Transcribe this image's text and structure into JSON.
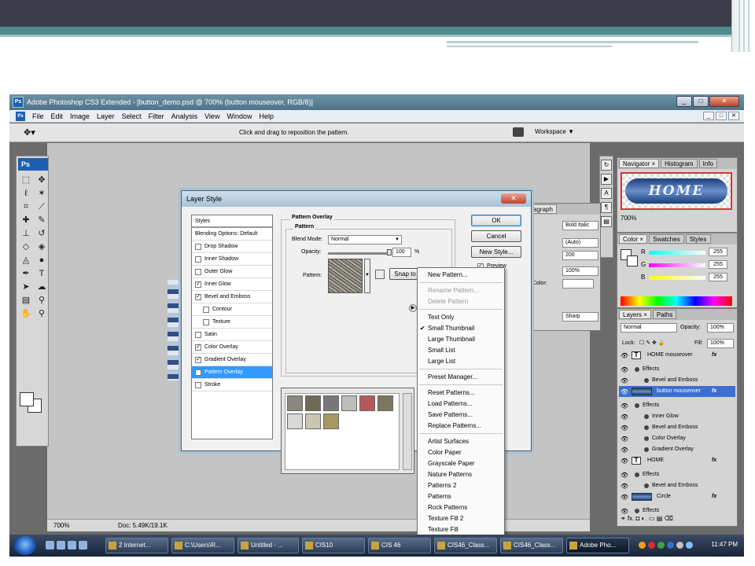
{
  "window": {
    "title": "Adobe Photoshop CS3 Extended - [button_demo.psd @ 700% (button mouseover, RGB/8)]",
    "app_icon": "Ps",
    "btn_min": "_",
    "btn_max": "□",
    "btn_close": "✕"
  },
  "menu": [
    "File",
    "Edit",
    "Image",
    "Layer",
    "Select",
    "Filter",
    "Analysis",
    "View",
    "Window",
    "Help"
  ],
  "options_bar": {
    "hint": "Click and drag to reposition the pattern.",
    "workspace": "Workspace ▼"
  },
  "toolbox": {
    "logo": "Ps"
  },
  "status": {
    "zoom": "700%",
    "doc": "Doc: 5.49K/19.1K"
  },
  "dialog": {
    "title": "Layer Style",
    "styles_header": "Styles",
    "blending": "Blending Options: Default",
    "style_items": [
      {
        "label": "Drop Shadow",
        "checked": false,
        "sub": false
      },
      {
        "label": "Inner Shadow",
        "checked": false,
        "sub": false
      },
      {
        "label": "Outer Glow",
        "checked": false,
        "sub": false
      },
      {
        "label": "Inner Glow",
        "checked": true,
        "sub": false
      },
      {
        "label": "Bevel and Emboss",
        "checked": true,
        "sub": false
      },
      {
        "label": "Contour",
        "checked": false,
        "sub": true
      },
      {
        "label": "Texture",
        "checked": false,
        "sub": true
      },
      {
        "label": "Satin",
        "checked": false,
        "sub": false
      },
      {
        "label": "Color Overlay",
        "checked": true,
        "sub": false
      },
      {
        "label": "Gradient Overlay",
        "checked": true,
        "sub": false
      },
      {
        "label": "Pattern Overlay",
        "checked": true,
        "sub": false,
        "selected": true
      },
      {
        "label": "Stroke",
        "checked": false,
        "sub": false
      }
    ],
    "section_title": "Pattern Overlay",
    "group_title": "Pattern",
    "blend_mode_label": "Blend Mode:",
    "blend_mode_value": "Normal",
    "opacity_label": "Opacity:",
    "opacity_value": "100",
    "opacity_unit": "%",
    "opacity": 1.0,
    "pattern_label": "Pattern:",
    "snap_label": "Snap to",
    "ok": "OK",
    "cancel": "Cancel",
    "new_style": "New Style...",
    "preview": "Preview",
    "preview_checked": true
  },
  "pattern_menu": {
    "items": [
      {
        "label": "New Pattern...",
        "disabled": false,
        "checked": false,
        "sep_after": true
      },
      {
        "label": "Rename Pattern...",
        "disabled": true,
        "checked": false,
        "sep_after": false
      },
      {
        "label": "Delete Pattern",
        "disabled": true,
        "checked": false,
        "sep_after": true
      },
      {
        "label": "Text Only",
        "disabled": false,
        "checked": false,
        "sep_after": false
      },
      {
        "label": "Small Thumbnail",
        "disabled": false,
        "checked": true,
        "sep_after": false
      },
      {
        "label": "Large Thumbnail",
        "disabled": false,
        "checked": false,
        "sep_after": false
      },
      {
        "label": "Small List",
        "disabled": false,
        "checked": false,
        "sep_after": false
      },
      {
        "label": "Large List",
        "disabled": false,
        "checked": false,
        "sep_after": true
      },
      {
        "label": "Preset Manager...",
        "disabled": false,
        "checked": false,
        "sep_after": true
      },
      {
        "label": "Reset Patterns...",
        "disabled": false,
        "checked": false,
        "sep_after": false
      },
      {
        "label": "Load Patterns...",
        "disabled": false,
        "checked": false,
        "sep_after": false
      },
      {
        "label": "Save Patterns...",
        "disabled": false,
        "checked": false,
        "sep_after": false
      },
      {
        "label": "Replace Patterns...",
        "disabled": false,
        "checked": false,
        "sep_after": true
      },
      {
        "label": "Artist Surfaces",
        "disabled": false,
        "checked": false,
        "sep_after": false
      },
      {
        "label": "Color Paper",
        "disabled": false,
        "checked": false,
        "sep_after": false
      },
      {
        "label": "Grayscale Paper",
        "disabled": false,
        "checked": false,
        "sep_after": false
      },
      {
        "label": "Nature Patterns",
        "disabled": false,
        "checked": false,
        "sep_after": false
      },
      {
        "label": "Patterns 2",
        "disabled": false,
        "checked": false,
        "sep_after": false
      },
      {
        "label": "Patterns",
        "disabled": false,
        "checked": false,
        "sep_after": false
      },
      {
        "label": "Rock Patterns",
        "disabled": false,
        "checked": false,
        "sep_after": false
      },
      {
        "label": "Texture Fill 2",
        "disabled": false,
        "checked": false,
        "sep_after": false
      },
      {
        "label": "Texture Fill",
        "disabled": false,
        "checked": false,
        "sep_after": false
      }
    ],
    "check_mark": "✔"
  },
  "char_panel": {
    "tab": "agraph",
    "font_style": "Bold Italic",
    "leading": "(Auto)",
    "tracking": "200",
    "scale": "100%",
    "color_label": "Color:",
    "aa": "Sharp"
  },
  "navigator": {
    "tabs": [
      "Navigator ×",
      "Histogram",
      "Info"
    ],
    "preview_text": "HOME",
    "zoom": "700%"
  },
  "color_panel": {
    "tabs": [
      "Color ×",
      "Swatches",
      "Styles"
    ],
    "channels": [
      {
        "label": "R",
        "value": "255"
      },
      {
        "label": "G",
        "value": "255"
      },
      {
        "label": "B",
        "value": "255"
      }
    ]
  },
  "layers_panel": {
    "tabs": [
      "Layers ×",
      "Paths"
    ],
    "blend": "Normal",
    "opacity_label": "Opacity:",
    "opacity": "100%",
    "lock_label": "Lock:",
    "fill_label": "Fill:",
    "fill": "100%",
    "rows": [
      {
        "type": "layer",
        "name": "HOME mouseover",
        "thumb": "T",
        "fx": true,
        "selected": false
      },
      {
        "type": "effects",
        "name": "Effects"
      },
      {
        "type": "effect",
        "name": "Bevel and Emboss"
      },
      {
        "type": "layer",
        "name": "button mouseover",
        "thumb": "blue",
        "fx": true,
        "selected": true
      },
      {
        "type": "effects",
        "name": "Effects"
      },
      {
        "type": "effect",
        "name": "Inner Glow"
      },
      {
        "type": "effect",
        "name": "Bevel and Emboss"
      },
      {
        "type": "effect",
        "name": "Color Overlay"
      },
      {
        "type": "effect",
        "name": "Gradient Overlay"
      },
      {
        "type": "layer",
        "name": "HOME",
        "thumb": "T",
        "fx": true,
        "selected": false
      },
      {
        "type": "effects",
        "name": "Effects"
      },
      {
        "type": "effect",
        "name": "Bevel and Emboss"
      },
      {
        "type": "layer",
        "name": "Circle",
        "thumb": "blue",
        "fx": true,
        "selected": false
      },
      {
        "type": "effects",
        "name": "Effects"
      }
    ],
    "fx_label": "fx",
    "footer_icons": "⚭ fx. ◘ ◐. ▭ ▤ ⌫"
  },
  "taskbar": {
    "tasks": [
      {
        "label": "2 Internet...",
        "active": false
      },
      {
        "label": "C:\\Users\\R...",
        "active": false
      },
      {
        "label": "Untitled - ...",
        "active": false
      },
      {
        "label": "CIS10",
        "active": false
      },
      {
        "label": "CIS 46",
        "active": false
      },
      {
        "label": "CIS46_Class...",
        "active": false
      },
      {
        "label": "CIS46_Class...",
        "active": false
      },
      {
        "label": "Adobe Pho...",
        "active": true
      }
    ],
    "clock": "11:47 PM"
  },
  "colors": {
    "slide_top": "#3b3d4b",
    "slide_teal": "#4f8a8c",
    "selection": "#3399ff",
    "button_blue": "#1a3f7c"
  }
}
